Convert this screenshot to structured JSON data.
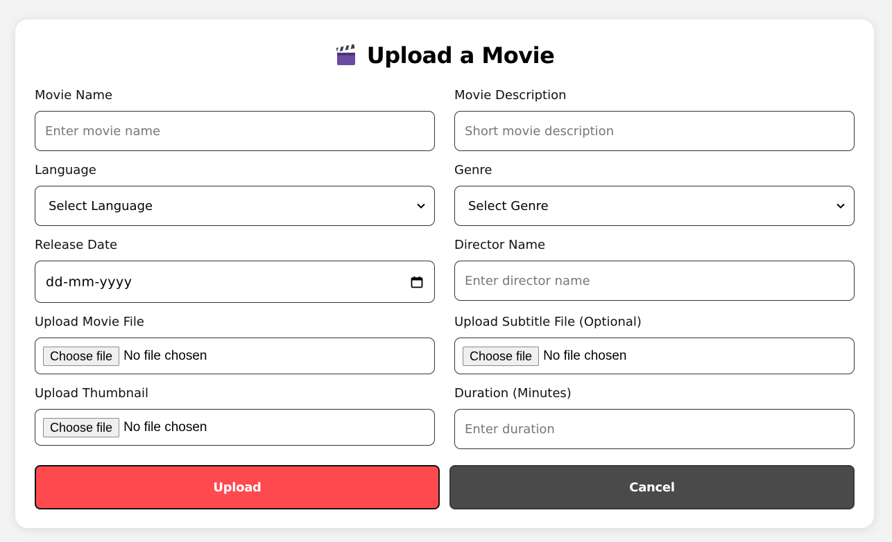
{
  "form": {
    "title": "Upload a Movie",
    "title_icon": "clapperboard-icon",
    "fields": {
      "movie_name": {
        "label": "Movie Name",
        "placeholder": "Enter movie name"
      },
      "movie_description": {
        "label": "Movie Description",
        "placeholder": "Short movie description"
      },
      "language": {
        "label": "Language",
        "selected": "Select Language"
      },
      "genre": {
        "label": "Genre",
        "selected": "Select Genre"
      },
      "release_date": {
        "label": "Release Date",
        "value": "dd-mm-yyyy"
      },
      "director_name": {
        "label": "Director Name",
        "placeholder": "Enter director name"
      },
      "movie_file": {
        "label": "Upload Movie File",
        "button": "Choose file",
        "status": "No file chosen"
      },
      "subtitle_file": {
        "label": "Upload Subtitle File (Optional)",
        "button": "Choose file",
        "status": "No file chosen"
      },
      "thumbnail": {
        "label": "Upload Thumbnail",
        "button": "Choose file",
        "status": "No file chosen"
      },
      "duration": {
        "label": "Duration (Minutes)",
        "placeholder": "Enter duration"
      }
    },
    "buttons": {
      "upload": "Upload",
      "cancel": "Cancel"
    },
    "colors": {
      "upload_button": "#fe4a4f",
      "cancel_button": "#4a4a4a",
      "card_background": "#ffffff",
      "page_background": "#f3f3f3"
    }
  }
}
